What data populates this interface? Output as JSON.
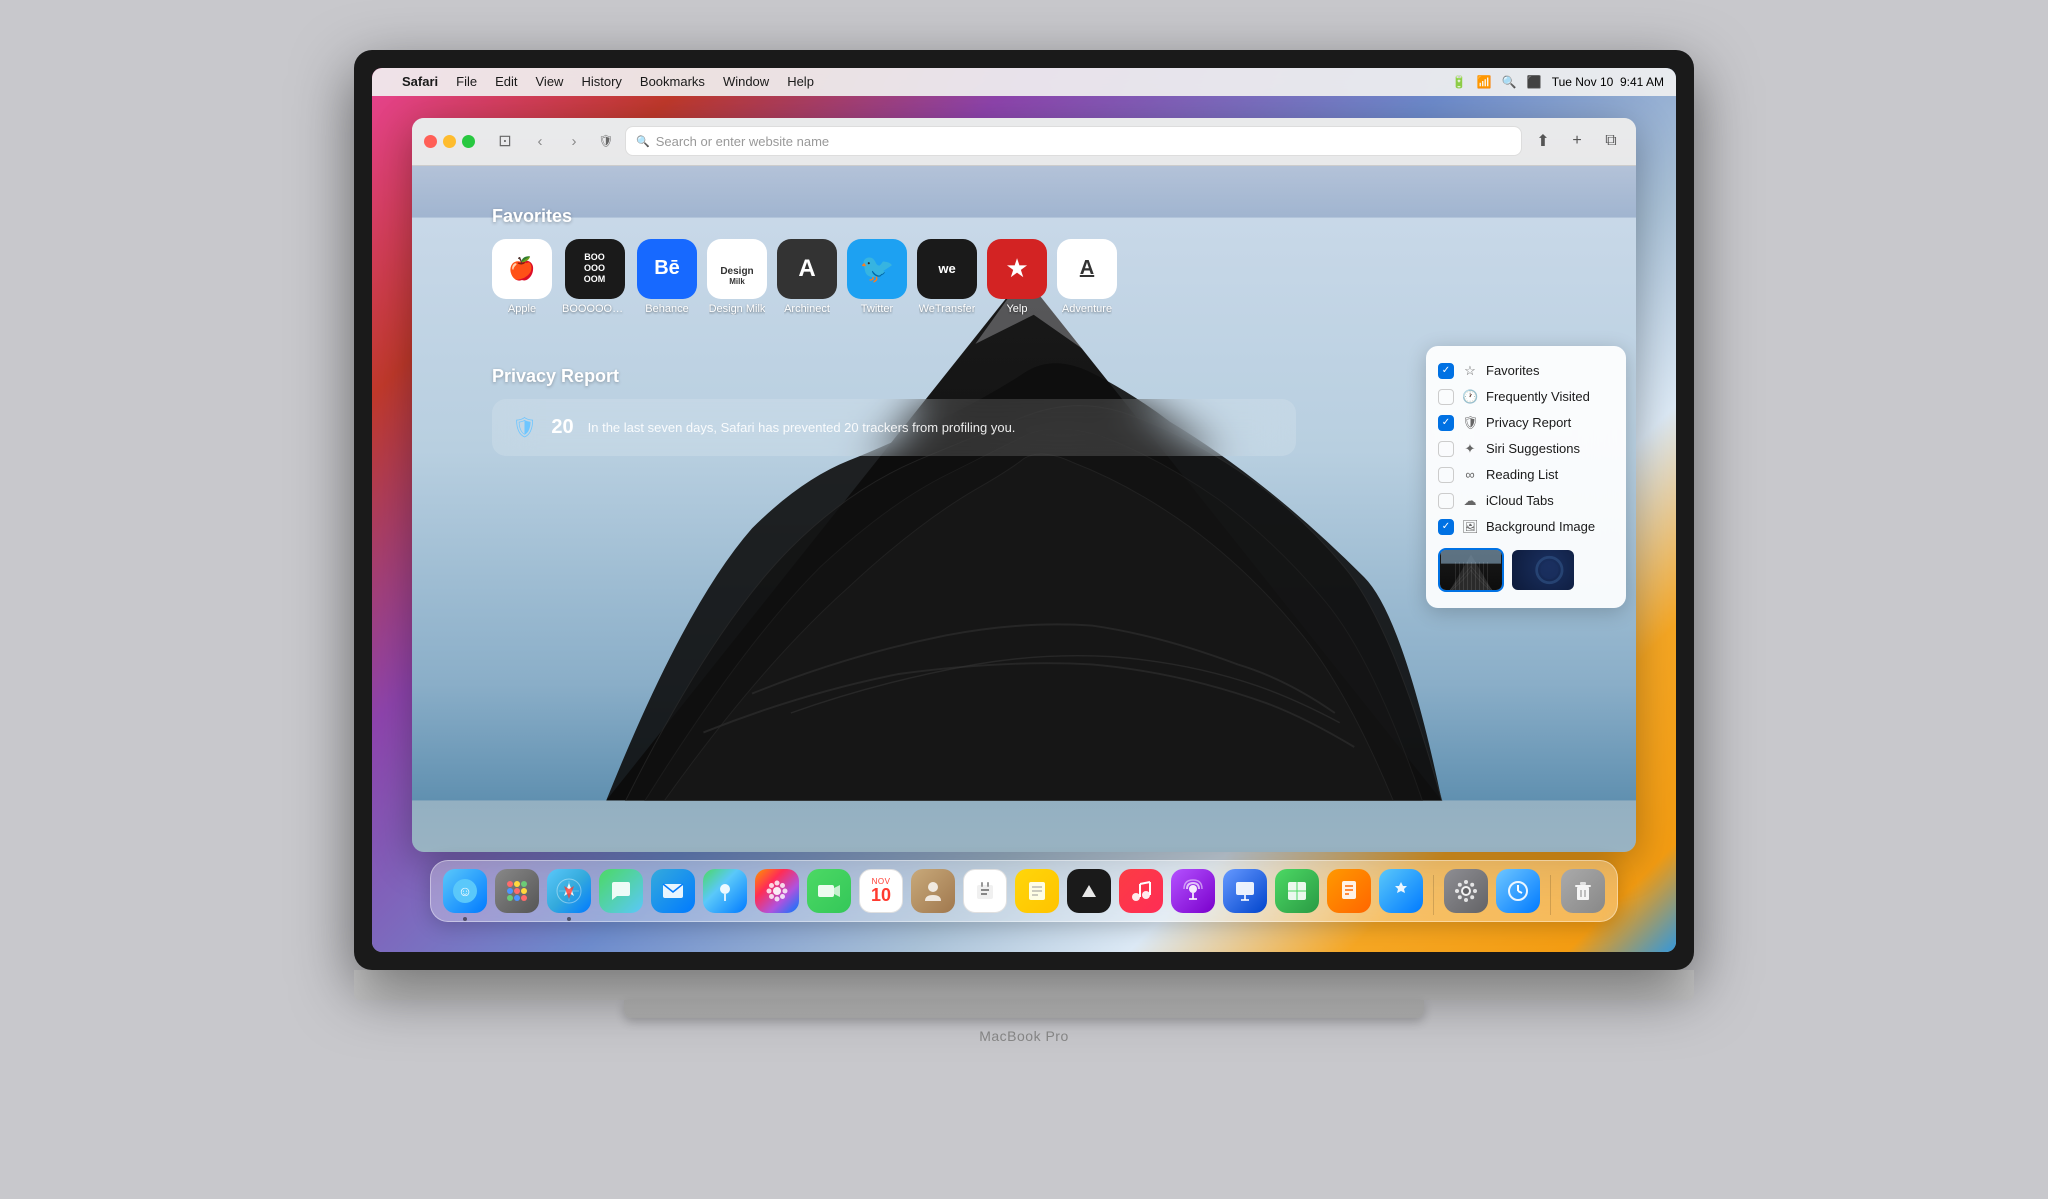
{
  "desktop": {
    "bg_colors": [
      "#e84393",
      "#8e44ad",
      "#6d8bcc",
      "#f5a623",
      "#3498db"
    ]
  },
  "menubar": {
    "apple_label": "",
    "app_name": "Safari",
    "items": [
      "File",
      "Edit",
      "View",
      "History",
      "Bookmarks",
      "Window",
      "Help"
    ],
    "right": {
      "time": "9:41 AM",
      "date": "Tue Nov 10"
    }
  },
  "browser": {
    "toolbar": {
      "back_label": "‹",
      "forward_label": "›",
      "share_label": "↑",
      "new_tab_label": "+",
      "tabs_label": "⧉",
      "address_placeholder": "Search or enter website name"
    },
    "content": {
      "favorites_title": "Favorites",
      "favorites": [
        {
          "label": "Apple",
          "icon": "🍎",
          "bg": "white"
        },
        {
          "label": "BOOOOOOM",
          "icon": "BOO\nOOO\nOOM",
          "bg": "#1a1a1a"
        },
        {
          "label": "Behance",
          "icon": "Bē",
          "bg": "#1769ff"
        },
        {
          "label": "Design Milk",
          "icon": "🥛",
          "bg": "white"
        },
        {
          "label": "Archinect",
          "icon": "A",
          "bg": "#333"
        },
        {
          "label": "Twitter",
          "icon": "🐦",
          "bg": "#1da1f2"
        },
        {
          "label": "WeTransfer",
          "icon": "we",
          "bg": "#1a1a1a"
        },
        {
          "label": "Yelp",
          "icon": "♨",
          "bg": "#d32323"
        },
        {
          "label": "Adventure",
          "icon": "A̲",
          "bg": "white"
        }
      ],
      "privacy_title": "Privacy Report",
      "privacy_count": "20",
      "privacy_shield": "🛡",
      "privacy_text": "In the last seven days, Safari has prevented 20 trackers from profiling you."
    },
    "customize_panel": {
      "items": [
        {
          "label": "Favorites",
          "checked": true,
          "icon": "☆"
        },
        {
          "label": "Frequently Visited",
          "checked": false,
          "icon": "🕐"
        },
        {
          "label": "Privacy Report",
          "checked": true,
          "icon": "🛡"
        },
        {
          "label": "Siri Suggestions",
          "checked": false,
          "icon": "🔮"
        },
        {
          "label": "Reading List",
          "checked": false,
          "icon": "∞"
        },
        {
          "label": "iCloud Tabs",
          "checked": false,
          "icon": "☁"
        },
        {
          "label": "Background Image",
          "checked": true,
          "icon": "🖼"
        }
      ]
    }
  },
  "dock": {
    "items": [
      {
        "name": "Finder",
        "emoji": "😊",
        "type": "finder",
        "has_dot": true
      },
      {
        "name": "Launchpad",
        "emoji": "⊞",
        "type": "launchpad",
        "has_dot": false
      },
      {
        "name": "Safari",
        "emoji": "🧭",
        "type": "safari",
        "has_dot": true
      },
      {
        "name": "Messages",
        "emoji": "💬",
        "type": "messages",
        "has_dot": false
      },
      {
        "name": "Mail",
        "emoji": "✉",
        "type": "mail",
        "has_dot": false
      },
      {
        "name": "Maps",
        "emoji": "🗺",
        "type": "maps",
        "has_dot": false
      },
      {
        "name": "Photos",
        "emoji": "🌸",
        "type": "photos",
        "has_dot": false
      },
      {
        "name": "FaceTime",
        "emoji": "📹",
        "type": "facetime",
        "has_dot": false
      },
      {
        "name": "Calendar",
        "emoji": "📅",
        "type": "calendar",
        "has_dot": false
      },
      {
        "name": "Contacts",
        "emoji": "👤",
        "type": "contacts",
        "has_dot": false
      },
      {
        "name": "Reminders",
        "emoji": "☑",
        "type": "reminders",
        "has_dot": false
      },
      {
        "name": "Notes",
        "emoji": "📝",
        "type": "notes",
        "has_dot": false
      },
      {
        "name": "Apple TV",
        "emoji": "📺",
        "type": "appletv",
        "has_dot": false
      },
      {
        "name": "Music",
        "emoji": "♪",
        "type": "music",
        "has_dot": false
      },
      {
        "name": "Podcasts",
        "emoji": "🎙",
        "type": "podcasts",
        "has_dot": false
      },
      {
        "name": "Keynote",
        "emoji": "🎞",
        "type": "keynote",
        "has_dot": false
      },
      {
        "name": "Numbers",
        "emoji": "📊",
        "type": "numbers",
        "has_dot": false
      },
      {
        "name": "Pages",
        "emoji": "📄",
        "type": "pages",
        "has_dot": false
      },
      {
        "name": "App Store",
        "emoji": "A",
        "type": "appstore",
        "has_dot": false
      },
      {
        "name": "System Preferences",
        "emoji": "⚙",
        "type": "sysprefs",
        "has_dot": false
      },
      {
        "name": "Screen Time",
        "emoji": "⏱",
        "type": "screentime",
        "has_dot": false
      },
      {
        "name": "Trash",
        "emoji": "🗑",
        "type": "trash",
        "has_dot": false
      }
    ],
    "calendar_month": "NOV",
    "calendar_day": "10"
  },
  "macbook_label": "MacBook Pro"
}
